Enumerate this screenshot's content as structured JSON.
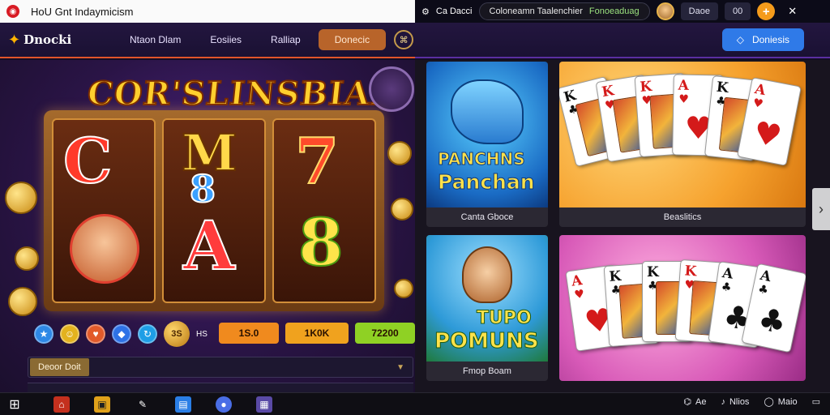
{
  "window": {
    "title": "HoU Gnt Indaymicism"
  },
  "top_right": {
    "left_label": "Ca Dacci",
    "pill_text": "Coloneamn Taalenchier",
    "pill_status": "Fonoeaduag",
    "account_label": "Daoe",
    "count_label": "00",
    "plus_label": "+"
  },
  "nav": {
    "brand": "Dnocki",
    "links": [
      "Ntaon Dlam",
      "Eosiies",
      "Ralliap"
    ],
    "active_button": "Donecic",
    "right_button": "Doniesis",
    "colors": {
      "accent": "#2f7ae8",
      "active": "#b8642a",
      "underline": "#e0552a"
    }
  },
  "slot": {
    "title": "COR'SLINSBIAL",
    "symbols": [
      "C",
      "M",
      "8",
      "A",
      "7",
      "8"
    ],
    "controls_label": "HS",
    "coin_label": "3S",
    "bets": [
      "1S.0",
      "1K0K",
      "72200"
    ],
    "search_button": "Deoor Doit",
    "colors": {
      "bet1": "#f08a1e",
      "bet2": "#f0a21e",
      "bet3": "#8fd124"
    }
  },
  "games": [
    {
      "label": "Canta Gboce",
      "art_line1": "PANCHNS",
      "art_line2": "Panchan"
    },
    {
      "label": "Beaslitics"
    },
    {
      "label": "Fmop Boam",
      "art_line1": "TUPO",
      "art_line2": "POMUNS"
    },
    {
      "label": ""
    }
  ],
  "cards_top": [
    {
      "rank": "K",
      "suit": "♣",
      "color": "blk"
    },
    {
      "rank": "K",
      "suit": "♥",
      "color": "red"
    },
    {
      "rank": "K",
      "suit": "♥",
      "color": "red"
    },
    {
      "rank": "A",
      "suit": "♥",
      "color": "red"
    },
    {
      "rank": "K",
      "suit": "♣",
      "color": "blk"
    },
    {
      "rank": "A",
      "suit": "♥",
      "color": "red"
    }
  ],
  "cards_bottom": [
    {
      "rank": "A",
      "suit": "♥",
      "color": "red"
    },
    {
      "rank": "K",
      "suit": "♣",
      "color": "blk"
    },
    {
      "rank": "K",
      "suit": "♣",
      "color": "blk"
    },
    {
      "rank": "K",
      "suit": "♥",
      "color": "red"
    },
    {
      "rank": "A",
      "suit": "♣",
      "color": "blk"
    },
    {
      "rank": "A",
      "suit": "♣",
      "color": "blk"
    }
  ],
  "taskbar": {
    "tray_items": [
      "Ae",
      "Nlios",
      "Maio",
      ""
    ]
  }
}
